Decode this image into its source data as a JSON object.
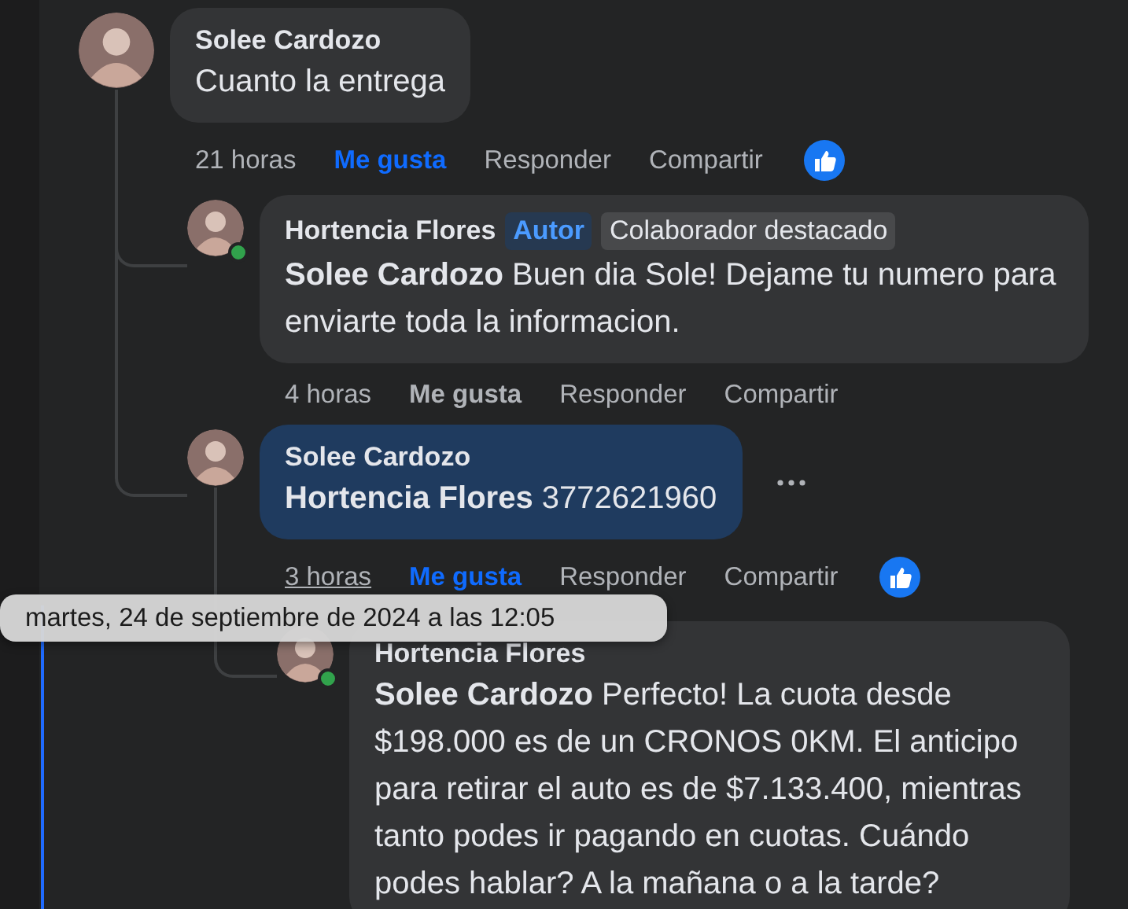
{
  "comments": [
    {
      "author": "Solee Cardozo",
      "text": "Cuanto la entrega",
      "highlighted": false,
      "time": "21 horas",
      "time_hovered": false,
      "like": "Me gusta",
      "liked": true,
      "reply": "Responder",
      "share": "Compartir",
      "reaction_shown": true,
      "children": [
        {
          "author": "Hortencia Flores",
          "badges": [
            {
              "label": "Autor",
              "kind": "author"
            },
            {
              "label": "Colaborador destacado",
              "kind": "contributor"
            }
          ],
          "text": "**Solee Cardozo** Buen dia Sole! Dejame tu numero para enviarte toda la informacion.",
          "highlighted": false,
          "online": true,
          "time": "4 horas",
          "time_hovered": false,
          "like": "Me gusta",
          "liked": false,
          "reply": "Responder",
          "share": "Compartir"
        },
        {
          "author": "Solee Cardozo",
          "text": "**Hortencia Flores** 3772621960",
          "highlighted": true,
          "more_button": true,
          "time": "3 horas",
          "time_hovered": true,
          "like": "Me gusta",
          "liked": true,
          "reply": "Responder",
          "share": "Compartir",
          "reaction_shown": true,
          "children": [
            {
              "author": "Hortencia Flores",
              "text": "**Solee Cardozo** Perfecto! La cuota desde $198.000 es de un CRONOS 0KM. El anticipo para retirar el auto es de $7.133.400, mientras tanto podes ir pagando en cuotas. Cuándo podes hablar? A la mañana o a la tarde?",
              "highlighted": false,
              "online": true
            }
          ]
        }
      ]
    }
  ],
  "tooltip": {
    "text": "martes, 24 de septiembre de 2024 a las 12:05"
  }
}
